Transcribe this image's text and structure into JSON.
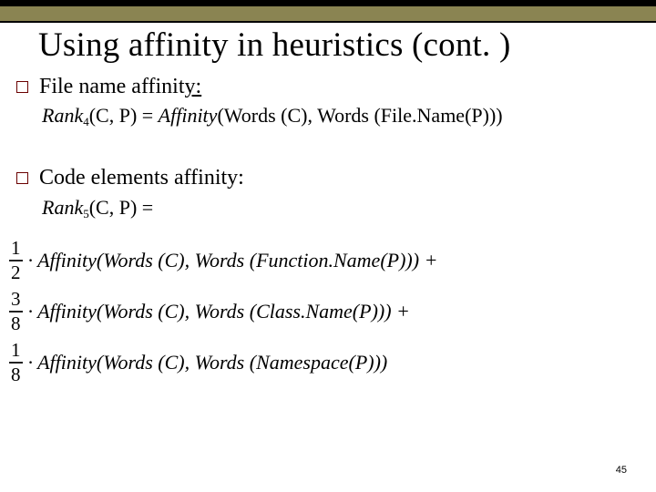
{
  "title": "Using affinity in heuristics (cont. )",
  "bullets": {
    "file": "File name affinit",
    "fileSuffix": "y:",
    "code": "Code elements affinity:"
  },
  "eq": {
    "rank4Left": "Rank",
    "rank4Sub": "4",
    "rank4Args": "(C, P) = ",
    "afw": "Affinity",
    "wordsC": "(Words (C), Words",
    "filename": " (File.Name(P))",
    "rank5Left": "Rank",
    "rank5Sub": "5",
    "rank5Args": "(C, P) ="
  },
  "terms": {
    "f1n": "1",
    "f1d": "2",
    "t1": " · Affinity(Words (C), Words (Function.Name(P))) +",
    "f2n": "3",
    "f2d": "8",
    "t2": " · Affinity(Words (C), Words (Class.Name(P))) +",
    "f3n": "1",
    "f3d": "8",
    "t3": " · Affinity(Words (C), Words (Namespace(P)))"
  },
  "pageNumber": "45"
}
